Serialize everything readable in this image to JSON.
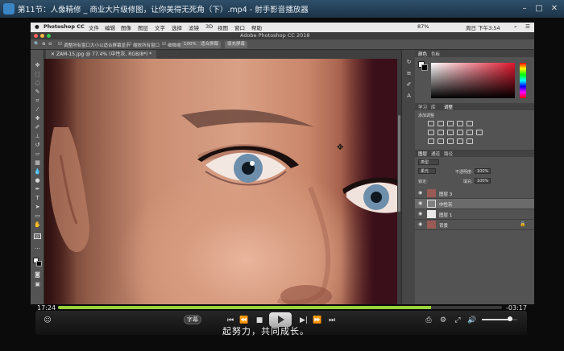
{
  "player": {
    "title": "第11节：人像精修 _ 商业大片级修图，让你美得无死角（下）.mp4 - 射手影音播放器",
    "window_buttons": [
      "–",
      "□",
      "✕"
    ]
  },
  "mac_menu": {
    "app": "Photoshop CC",
    "items": [
      "文件",
      "编辑",
      "图像",
      "图层",
      "文字",
      "选择",
      "滤镜",
      "3D",
      "视图",
      "窗口",
      "帮助"
    ],
    "status_right": "87%",
    "time": "周日 下午3:54"
  },
  "ps": {
    "window_title": "Adobe Photoshop CC 2018",
    "options": {
      "checkbox1": "调整所有窗口大小以适合屏幕显示",
      "checkbox2": "缩放所有窗口",
      "checkbox3": "细微缩放",
      "btn_100": "100%",
      "btn_fit": "适合屏幕",
      "btn_fill": "填充屏幕"
    },
    "doc_tab": "ZAM-15.jpg @ 77.4% (中性灰, RGB/8*) *",
    "color_tabs": [
      "颜色",
      "色板"
    ],
    "adjust_tabs": [
      "学习",
      "库",
      "调整"
    ],
    "adjust_heading": "添加调整",
    "layers_tabs": [
      "图层",
      "通道",
      "路径"
    ],
    "kind_label": "类型",
    "blend_mode": "柔光",
    "opacity_label": "不透明度:",
    "opacity_value": "100%",
    "lock_label": "锁定:",
    "fill_label": "填充:",
    "fill_value": "100%",
    "layers": [
      {
        "name": "图层 3"
      },
      {
        "name": "中性灰"
      },
      {
        "name": "图层 1"
      },
      {
        "name": "背景"
      }
    ]
  },
  "playback": {
    "current_time": "17:24",
    "remaining_time": "-03:17",
    "progress_fraction": 0.84,
    "subtitle_button": "字幕",
    "subtitle_text": "起努力，共同成长。",
    "volume_fraction": 0.8
  },
  "colors": {
    "accent_progress": "#9ad33a",
    "player_titlebar": "#2f4f69",
    "ps_panel": "#535353"
  }
}
